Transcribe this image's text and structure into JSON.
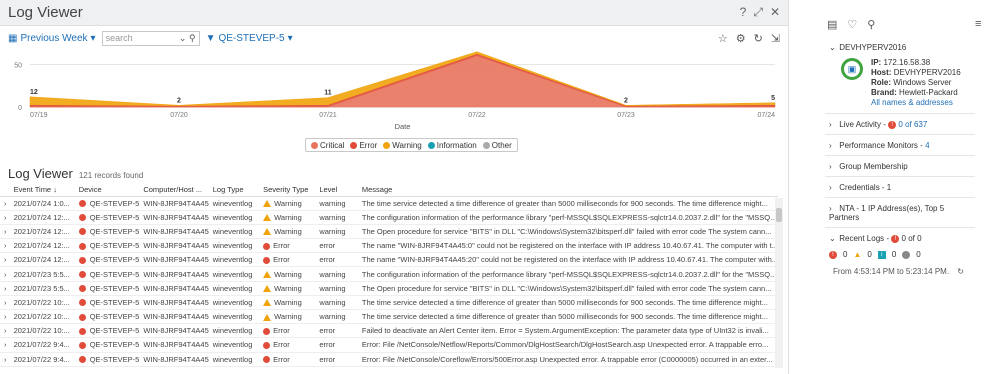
{
  "panel": {
    "title": "Log Viewer",
    "header_icons": [
      "help-icon",
      "expand-icon",
      "close-icon"
    ]
  },
  "toolbar": {
    "period_label": "Previous Week",
    "search_placeholder": "search",
    "filter_label": "QE-STEVEP-5"
  },
  "chart_data": {
    "type": "area",
    "x": [
      "07/19",
      "07/20",
      "07/21",
      "07/22",
      "07/23",
      "07/24"
    ],
    "xlabel": "Date",
    "ylim": [
      0,
      60
    ],
    "yticks": [
      "0",
      "50"
    ],
    "series": [
      {
        "name": "Critical",
        "color": "#e8735c",
        "values": [
          0,
          0,
          0,
          60,
          0,
          0
        ]
      },
      {
        "name": "Error",
        "color": "#e04b3a",
        "values": [
          2,
          1,
          2,
          2,
          1,
          2
        ]
      },
      {
        "name": "Warning",
        "color": "#f0a30a",
        "values": [
          10,
          1,
          9,
          3,
          1,
          3
        ]
      },
      {
        "name": "Information",
        "color": "#1aa0b5",
        "values": [
          0,
          0,
          0,
          0,
          0,
          0
        ]
      },
      {
        "name": "Other",
        "color": "#aaaaaa",
        "values": [
          0,
          0,
          0,
          0,
          0,
          0
        ]
      }
    ],
    "point_labels": [
      "12",
      "2",
      "11",
      "",
      "2",
      "5"
    ]
  },
  "list": {
    "title": "Log Viewer",
    "count": "121 records found",
    "columns": [
      "Event Time",
      "Device",
      "Computer/Host ...",
      "Log Type",
      "Severity Type",
      "Level",
      "Message"
    ],
    "rows": [
      {
        "time": "2021/07/24 1:0...",
        "device": "QE-STEVEP-5",
        "host": "WIN-8JRF94T4A45",
        "logtype": "wineventlog",
        "severity": "Warning",
        "level": "warning",
        "message": "The time service detected a time difference of greater than 5000 milliseconds for 900 seconds. The time difference might..."
      },
      {
        "time": "2021/07/24 12:...",
        "device": "QE-STEVEP-5",
        "host": "WIN-8JRF94T4A45",
        "logtype": "wineventlog",
        "severity": "Warning",
        "level": "warning",
        "message": "The configuration information of the performance library \"perf-MSSQL$SQLEXPRESS-sqlctr14.0.2037.2.dll\" for the \"MSSQ..."
      },
      {
        "time": "2021/07/24 12:...",
        "device": "QE-STEVEP-5",
        "host": "WIN-8JRF94T4A45",
        "logtype": "wineventlog",
        "severity": "Warning",
        "level": "warning",
        "message": "The Open procedure for service \"BITS\" in DLL \"C:\\Windows\\System32\\bitsperf.dll\" failed with error code The system cann..."
      },
      {
        "time": "2021/07/24 12:...",
        "device": "QE-STEVEP-5",
        "host": "WIN-8JRF94T4A45",
        "logtype": "wineventlog",
        "severity": "Error",
        "level": "error",
        "message": "The name \"WIN-8JRF94T4A45:0\" could not be registered on the interface with IP address 10.40.67.41. The computer with t..."
      },
      {
        "time": "2021/07/24 12:...",
        "device": "QE-STEVEP-5",
        "host": "WIN-8JRF94T4A45",
        "logtype": "wineventlog",
        "severity": "Error",
        "level": "error",
        "message": "The name \"WIN-8JRF94T4A45:20\" could not be registered on the interface with IP address 10.40.67.41. The computer with..."
      },
      {
        "time": "2021/07/23 5:5...",
        "device": "QE-STEVEP-5",
        "host": "WIN-8JRF94T4A45",
        "logtype": "wineventlog",
        "severity": "Warning",
        "level": "warning",
        "message": "The configuration information of the performance library \"perf-MSSQL$SQLEXPRESS-sqlctr14.0.2037.2.dll\" for the \"MSSQ..."
      },
      {
        "time": "2021/07/23 5:5...",
        "device": "QE-STEVEP-5",
        "host": "WIN-8JRF94T4A45",
        "logtype": "wineventlog",
        "severity": "Warning",
        "level": "warning",
        "message": "The Open procedure for service \"BITS\" in DLL \"C:\\Windows\\System32\\bitsperf.dll\" failed with error code The system cann..."
      },
      {
        "time": "2021/07/22 10:...",
        "device": "QE-STEVEP-5",
        "host": "WIN-8JRF94T4A45",
        "logtype": "wineventlog",
        "severity": "Warning",
        "level": "warning",
        "message": "The time service detected a time difference of greater than 5000 milliseconds for 900 seconds. The time difference might..."
      },
      {
        "time": "2021/07/22 10:...",
        "device": "QE-STEVEP-5",
        "host": "WIN-8JRF94T4A45",
        "logtype": "wineventlog",
        "severity": "Warning",
        "level": "warning",
        "message": "The time service detected a time difference of greater than 5000 milliseconds for 900 seconds. The time difference might..."
      },
      {
        "time": "2021/07/22 10:...",
        "device": "QE-STEVEP-5",
        "host": "WIN-8JRF94T4A45",
        "logtype": "wineventlog",
        "severity": "Error",
        "level": "error",
        "message": "Failed to deactivate an Alert Center item. Error = System.ArgumentException: The parameter data type of UInt32 is invali..."
      },
      {
        "time": "2021/07/22 9:4...",
        "device": "QE-STEVEP-5",
        "host": "WIN-8JRF94T4A45",
        "logtype": "wineventlog",
        "severity": "Error",
        "level": "error",
        "message": "Error: File /NetConsole/Netflow/Reports/Common/DlgHostSearch/DlgHostSearch.asp Unexpected error. A trappable erro..."
      },
      {
        "time": "2021/07/22 9:4...",
        "device": "QE-STEVEP-5",
        "host": "WIN-8JRF94T4A45",
        "logtype": "wineventlog",
        "severity": "Error",
        "level": "error",
        "message": "Error: File /NetConsole/Coreflow/Errors/500Error.asp Unexpected error. A trappable error (C0000005) occurred in an exter..."
      }
    ]
  },
  "side": {
    "node_name": "DEVHYPERV2016",
    "ip": "172.16.58.38",
    "host": "DEVHYPERV2016",
    "role": "Windows Server",
    "brand": "Hewlett-Packard",
    "names_link": "All names & addresses",
    "live_activity": "Live Activity -",
    "live_count": "0 of 637",
    "perf_monitors": "Performance Monitors -",
    "perf_count": "4",
    "group_membership": "Group Membership",
    "credentials": "Credentials - 1",
    "nta": "NTA - 1 IP Address(es), Top 5 Partners",
    "recent_logs": "Recent Logs -",
    "recent_count": "0 of 0",
    "counts": [
      "0",
      "0",
      "0",
      "0"
    ],
    "time_range": "From 4:53:14 PM to 5:23:14 PM."
  }
}
